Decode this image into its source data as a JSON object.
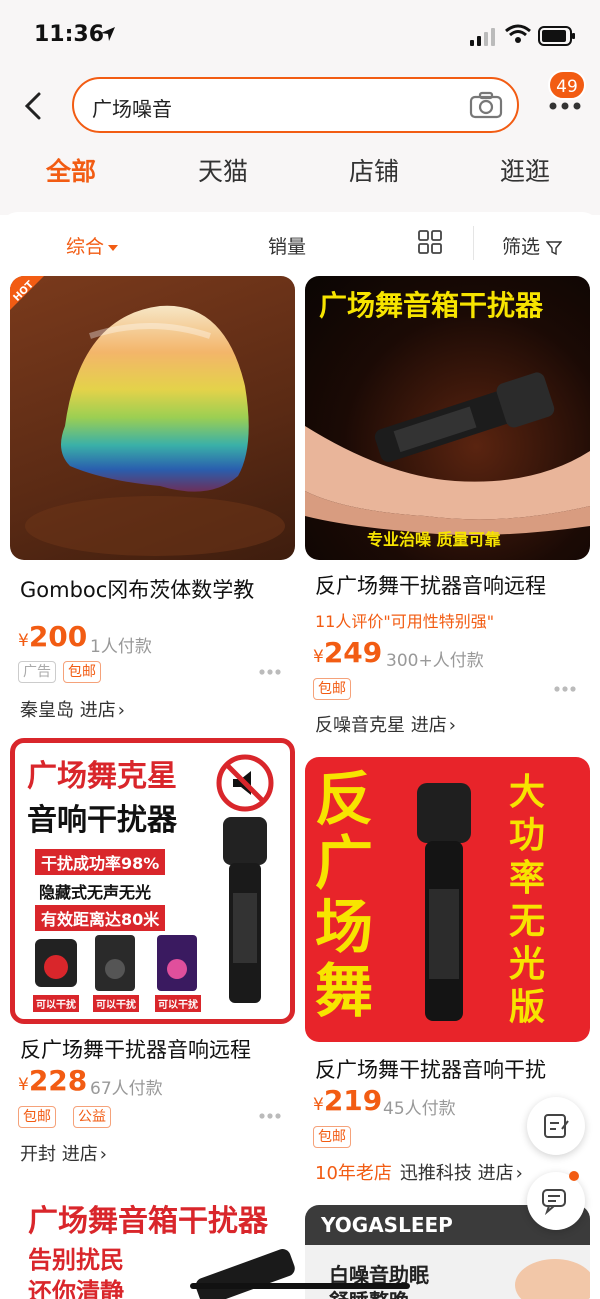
{
  "status_bar": {
    "time": "11:36"
  },
  "header": {
    "search_value": "广场噪音",
    "cart_badge": "49"
  },
  "tabs": [
    "全部",
    "天猫",
    "店铺",
    "逛逛"
  ],
  "filter": {
    "sort_label": "综合",
    "sales_label": "销量",
    "filter_label": "筛选"
  },
  "products": [
    {
      "title": "Gomboc冈布茨体数学教",
      "currency": "¥",
      "price": "200",
      "paid": "1人付款",
      "tags": [
        "广告",
        "包邮"
      ],
      "shop": "秦皇岛",
      "shop_link": "进店",
      "image_badge": "HOT"
    },
    {
      "title": "反广场舞干扰器音响远程",
      "review_note": "11人评价\"可用性特别强\"",
      "currency": "¥",
      "price": "249",
      "paid": "300+人付款",
      "tags": [
        "包邮"
      ],
      "shop": "反噪音克星",
      "shop_link": "进店",
      "image_title": "广场舞音箱干扰器",
      "image_caption": "专业治噪  质量可靠"
    },
    {
      "title": "反广场舞干扰器音响远程",
      "currency": "¥",
      "price": "228",
      "paid": "67人付款",
      "tags": [
        "包邮",
        "公益"
      ],
      "shop": "开封",
      "shop_link": "进店",
      "image_lines": [
        "广场舞克星",
        "音响干扰器",
        "干扰成功率98%",
        "隐藏式无声无光",
        "有效距离达80米"
      ],
      "image_small_labels": [
        "可以干扰",
        "可以干扰",
        "可以干扰"
      ]
    },
    {
      "title": "反广场舞干扰器音响干扰",
      "currency": "¥",
      "price": "219",
      "paid": "45人付款",
      "tags": [
        "包邮"
      ],
      "shop_age": "10年老店",
      "shop": "迅推科技",
      "shop_link": "进店",
      "image_left": [
        "反",
        "广",
        "场",
        "舞"
      ],
      "image_right": [
        "大",
        "功",
        "率",
        "无",
        "光",
        "版"
      ]
    },
    {
      "image_title": "广场舞音箱干扰器",
      "image_lines": [
        "告别扰民",
        "还你清静"
      ]
    },
    {
      "image_brand": "YOGASLEEP",
      "image_lines": [
        "白噪音助眠",
        "舒睡整晚"
      ]
    }
  ],
  "colors": {
    "accent": "#f25c13",
    "image_red": "#e8242a",
    "yellow": "#f7e400"
  }
}
